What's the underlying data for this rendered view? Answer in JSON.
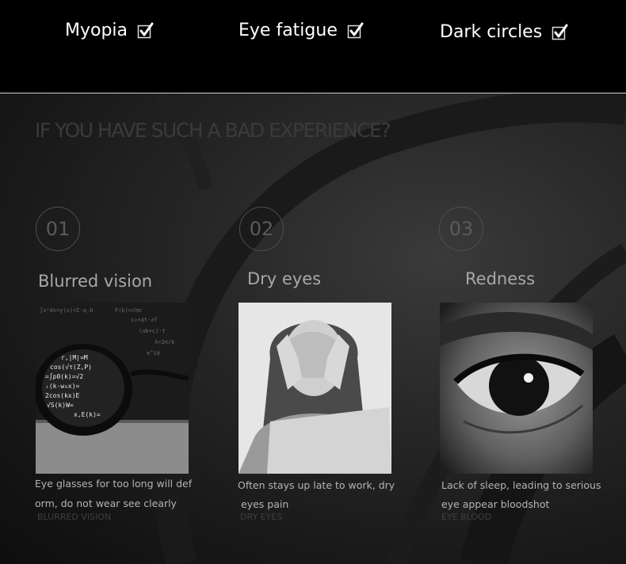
{
  "header": {
    "items": [
      {
        "label": "Myopia",
        "checked": true
      },
      {
        "label": "Eye fatigue",
        "checked": true
      },
      {
        "label": "Dark circles",
        "checked": true
      }
    ]
  },
  "main": {
    "headline": "IF YOU HAVE SUCH A BAD EXPERIENCE?",
    "cards": [
      {
        "number": "01",
        "title": "Blurred vision",
        "image": "glasses-on-chalkboard-image",
        "desc_line1": "Eye glasses for too long will def",
        "desc_line2": "orm, do not wear see clearly",
        "sub": "BLURRED VISION"
      },
      {
        "number": "02",
        "title": "Dry eyes",
        "image": "woman-covering-eyes-image",
        "desc_line1": "Often stays up late to work, dry",
        "desc_line2": "eyes pain",
        "sub": "DRY EYES"
      },
      {
        "number": "03",
        "title": "Redness",
        "image": "eye-closeup-image",
        "desc_line1": "Lack of sleep, leading to serious",
        "desc_line2": "eye appear bloodshot",
        "sub": "EYE BLOOD"
      }
    ]
  },
  "colors": {
    "background": "#000000",
    "panel": "#262626",
    "text_light": "#ffffff",
    "text_muted": "#a8a8a8"
  }
}
